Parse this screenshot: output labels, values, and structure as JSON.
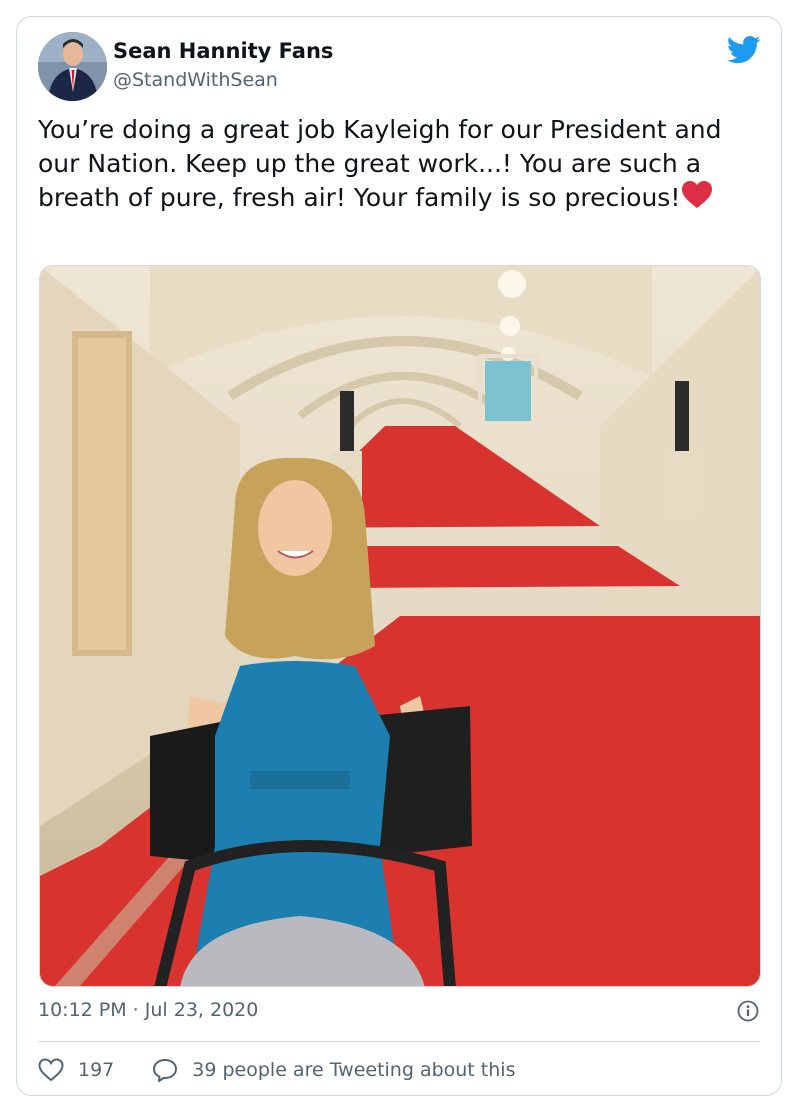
{
  "tweet": {
    "author_name": "Sean Hannity Fans",
    "author_handle": "@StandWithSean",
    "text": "You’re doing a great job Kayleigh for our President and our Nation. Keep up the great work...! You are such a breath of pure, fresh air! Your family is so precious!",
    "timestamp": "10:12 PM · Jul 23, 2020",
    "like_count": "197",
    "retweet_text": "39 people are Tweeting about this"
  },
  "colors": {
    "twitter_blue": "#1d9bf0",
    "text_secondary": "#536471",
    "heart_red": "#dd2e44",
    "carpet_red": "#d8332f",
    "dress_blue": "#1c7fb0"
  },
  "icons": {
    "logo": "twitter-bird-icon",
    "info": "info-icon",
    "like": "heart-outline-icon",
    "reply": "speech-bubble-icon",
    "emoji": "red-heart-emoji"
  }
}
